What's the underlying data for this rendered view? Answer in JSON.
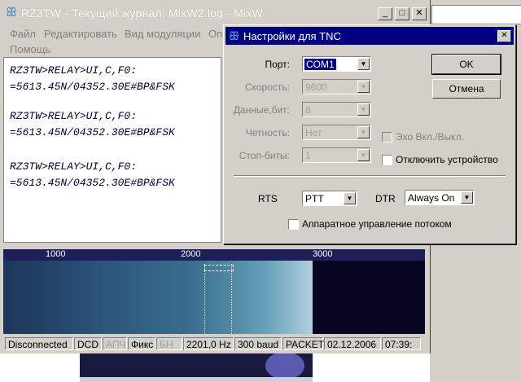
{
  "main_window": {
    "title": "RZ3TW - Текущий журнал: MixW2.log - MixW",
    "buttons": {
      "minimize": "_",
      "maximize": "□",
      "close": "✕"
    },
    "menu": [
      "Файл",
      "Редактировать",
      "Вид модуляции",
      "Оп",
      "Помощь"
    ],
    "log_lines": [
      "RZ3TW>RELAY>UI,C,F0:",
      "=5613.45N/04352.30E#BP&FSK",
      "RZ3TW>RELAY>UI,C,F0:",
      "=5613.45N/04352.30E#BP&FSK",
      "RZ3TW>RELAY>UI,C,F0:",
      "=5613.45N/04352.30E#BP&FSK"
    ]
  },
  "waterfall": {
    "scale_labels": [
      "1000",
      "2000",
      "3000"
    ]
  },
  "status_bar": {
    "connection": "Disconnected",
    "dcd": "DCD",
    "afc": "АПЧ",
    "fix": "Фикс",
    "bn": "БН",
    "frequency": "2201,0 Hz",
    "baud": "300 baud",
    "mode": "PACKET",
    "date": "02.12.2006",
    "time": "07:39:"
  },
  "dialog": {
    "title": "Настройки для TNC",
    "close": "✕",
    "fields": {
      "port": {
        "label": "Порт:",
        "value": "COM1"
      },
      "speed": {
        "label": "Скорость:",
        "value": "9600"
      },
      "data_bits": {
        "label": "Данные,бит:",
        "value": "8"
      },
      "parity": {
        "label": "Четность:",
        "value": "Нет"
      },
      "stop_bits": {
        "label": "Стоп-биты:",
        "value": "1"
      }
    },
    "ok": "OK",
    "cancel": "Отмена",
    "echo_label": "Эхо Вкл./Выкл.",
    "disable_device_label": "Отключить устройство",
    "rts": {
      "label": "RTS",
      "value": "PTT"
    },
    "dtr": {
      "label": "DTR",
      "value": "Always On"
    },
    "hw_flow_label": "Аппаратное управление потоком"
  },
  "icons": {
    "app_logo": "butterfly-icon",
    "dropdown": "chevron-down-icon"
  },
  "colors": {
    "dialog_title": "#000080",
    "window_face": "#d4d0c8",
    "waterfall_bg": "#0c0c2a",
    "text": "#000033"
  }
}
